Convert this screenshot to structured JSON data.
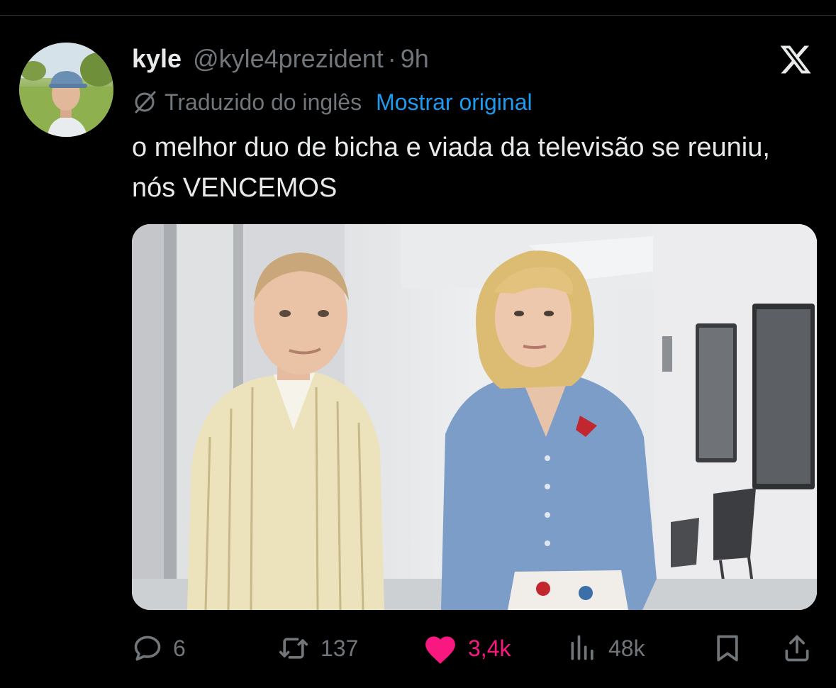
{
  "tweet": {
    "author_name": "kyle",
    "author_handle": "@kyle4prezident",
    "separator": "·",
    "time": "9h",
    "translation_label": "Traduzido do inglês",
    "show_original_label": "Mostrar original",
    "text": "o melhor duo de bicha e viada da televisão se reuniu, nós VENCEMOS"
  },
  "actions": {
    "replies": "6",
    "reposts": "137",
    "likes": "3,4k",
    "views": "48k"
  },
  "colors": {
    "background": "#000000",
    "link": "#1d9bf0",
    "like": "#f91880",
    "muted": "#71767b"
  },
  "icons": [
    "x-logo-icon",
    "globe-slash-icon",
    "reply-icon",
    "repost-icon",
    "heart-icon",
    "views-icon",
    "bookmark-icon",
    "share-icon"
  ]
}
